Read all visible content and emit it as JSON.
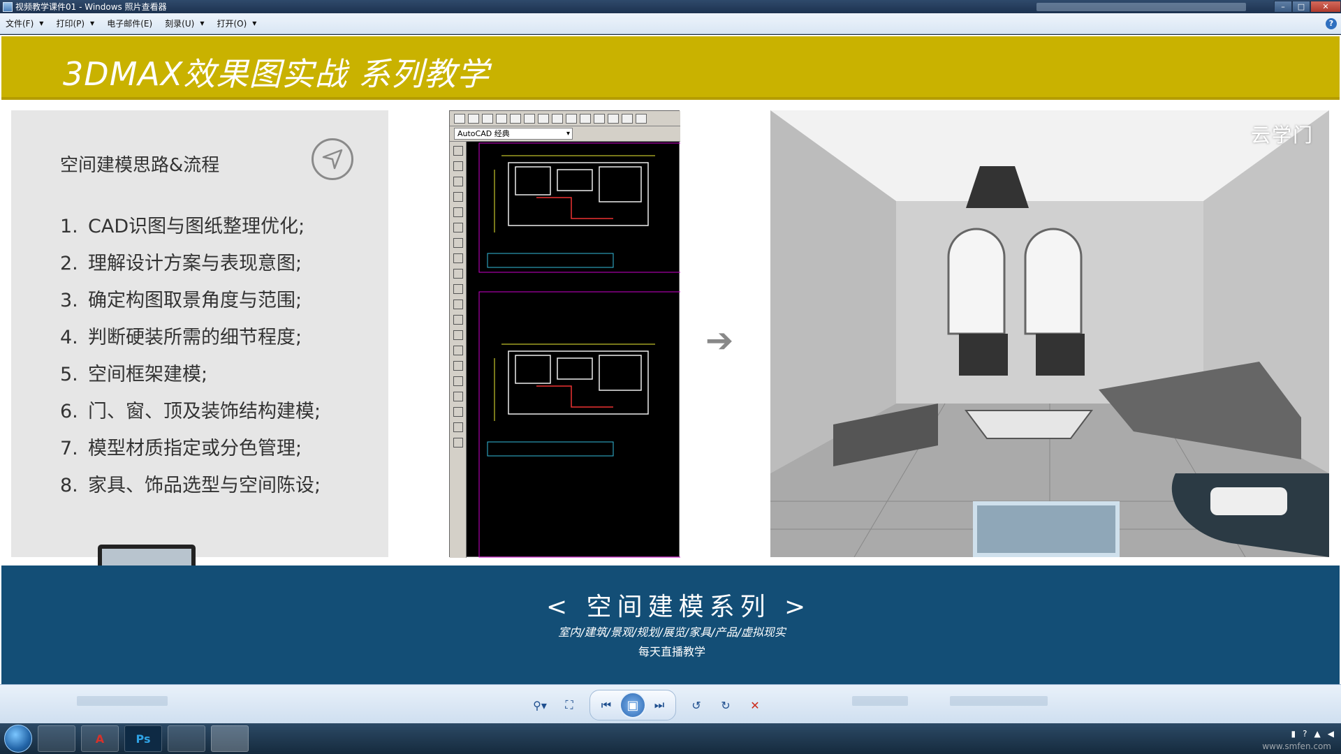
{
  "window": {
    "title": "视频教学课件01 - Windows 照片查看器",
    "controls": [
      "–",
      "□",
      "✕"
    ]
  },
  "menu": {
    "items": [
      {
        "label": "文件(F)"
      },
      {
        "label": "打印(P)"
      },
      {
        "label": "电子邮件(E)"
      },
      {
        "label": "刻录(U)"
      },
      {
        "label": "打开(O)"
      }
    ],
    "help_icon": "?"
  },
  "slide": {
    "banner_title": "3DMAX效果图实战  系列教学",
    "panel_heading": "空间建模思路&流程",
    "steps": [
      {
        "num": "1.",
        "text": "CAD识图与图纸整理优化;"
      },
      {
        "num": "2.",
        "text": "理解设计方案与表现意图;"
      },
      {
        "num": "3.",
        "text": "确定构图取景角度与范围;"
      },
      {
        "num": "4.",
        "text": "判断硬装所需的细节程度;"
      },
      {
        "num": "5.",
        "text": "空间框架建模;"
      },
      {
        "num": "6.",
        "text": "门、窗、顶及装饰结构建模;"
      },
      {
        "num": "7.",
        "text": "模型材质指定或分色管理;"
      },
      {
        "num": "8.",
        "text": "家具、饰品选型与空间陈设;"
      }
    ],
    "cad_workspace": "AutoCAD 经典",
    "arrow": "➔",
    "room_logo": "云学门",
    "bottom_title": "<  空间建模系列  >",
    "bottom_subtitle": "室内/建筑/景观/规划/展览/家具/产品/虚拟现实",
    "bottom_subtitle2": "每天直播教学"
  },
  "viewer_controls": {
    "zoom": "⚲▾",
    "fit": "⛶",
    "prev": "⏮",
    "slideshow": "▣",
    "next": "⏭",
    "rotate_ccw": "↺",
    "rotate_cw": "↻",
    "delete": "✕"
  },
  "taskbar": {
    "apps": [
      {
        "name": "explorer",
        "label": "",
        "color": "#e8c45a"
      },
      {
        "name": "autocad",
        "label": "A",
        "color": "#d6322b"
      },
      {
        "name": "photoshop",
        "label": "Ps",
        "color": "#2fa3e6"
      },
      {
        "name": "3dsmax",
        "label": "",
        "color": "#1fa49a"
      },
      {
        "name": "photo-viewer",
        "label": "",
        "color": "#5c8fcf"
      }
    ],
    "watermark": "www.smfen.com"
  }
}
